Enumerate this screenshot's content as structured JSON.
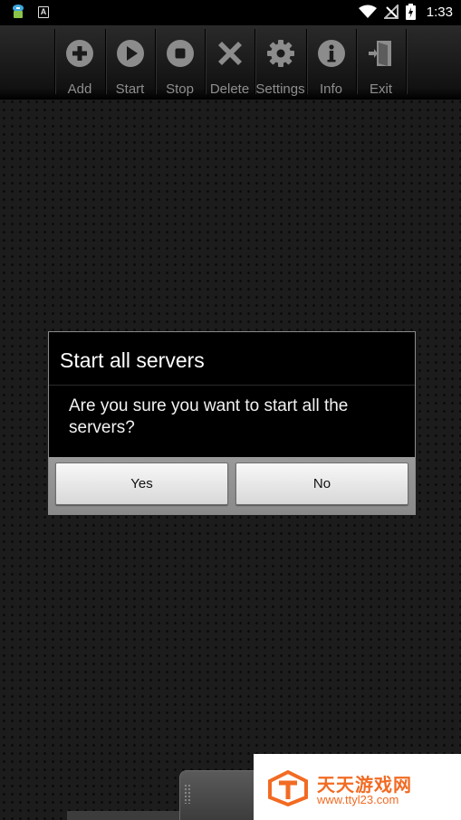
{
  "status_bar": {
    "time": "1:33",
    "left_icons": [
      "android-robot-icon",
      "a-notification-icon"
    ],
    "right_icons": [
      "wifi-icon",
      "no-sim-icon",
      "battery-icon"
    ]
  },
  "toolbar": {
    "items": [
      {
        "label": "Add",
        "icon": "plus-circle-icon"
      },
      {
        "label": "Start",
        "icon": "play-circle-icon"
      },
      {
        "label": "Stop",
        "icon": "stop-circle-icon"
      },
      {
        "label": "Delete",
        "icon": "x-icon"
      },
      {
        "label": "Settings",
        "icon": "gear-icon"
      },
      {
        "label": "Info",
        "icon": "info-circle-icon"
      },
      {
        "label": "Exit",
        "icon": "exit-door-icon"
      }
    ]
  },
  "dialog": {
    "title": "Start all servers",
    "message": "Are you sure you want to start all the servers?",
    "yes_label": "Yes",
    "no_label": "No"
  },
  "a_icon_text": "A",
  "watermark": {
    "name": "天天游戏网",
    "url": "www.ttyl23.com"
  },
  "colors": {
    "background": "#1c1c1c",
    "toolbar_label": "#8e8e8e",
    "watermark_accent": "#f26b23"
  }
}
